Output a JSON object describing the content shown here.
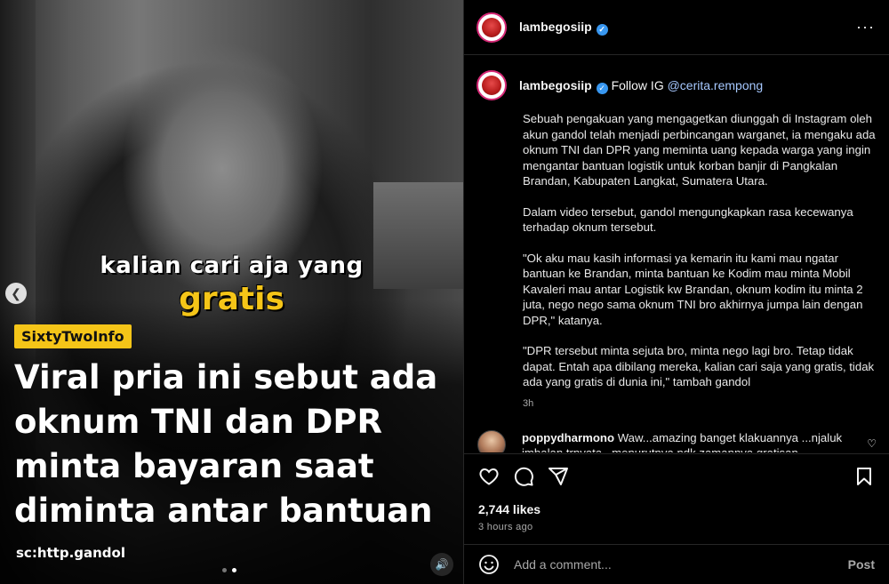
{
  "media": {
    "caption_line1": "kalian cari aja yang",
    "caption_line2": "gratis",
    "badge": "SixtyTwoInfo",
    "headline": "Viral pria ini sebut ada oknum TNI dan DPR minta bayaran saat diminta antar bantuan",
    "source": "sc:http.gandol"
  },
  "header": {
    "username": "lambegosiip"
  },
  "caption": {
    "username": "lambegosiip",
    "follow_text": "Follow IG",
    "mention": "@cerita.rempong",
    "paragraphs": [
      "Sebuah pengakuan yang mengagetkan diunggah di Instagram oleh akun gandol telah menjadi perbincangan warganet, ia mengaku ada oknum TNI dan DPR yang meminta uang kepada warga yang ingin mengantar bantuan logistik untuk korban banjir di Pangkalan Brandan, Kabupaten Langkat, Sumatera Utara.",
      "Dalam video tersebut, gandol mengungkapkan rasa kecewanya terhadap oknum tersebut.",
      "\"Ok aku mau kasih informasi ya kemarin itu kami mau ngatar bantuan ke Brandan, minta bantuan ke Kodim mau minta Mobil Kavaleri mau antar Logistik kw Brandan, oknum kodim itu minta 2 juta, nego nego sama oknum TNI bro akhirnya jumpa lain dengan DPR,\" katanya.",
      "\"DPR tersebut minta sejuta bro, minta nego lagi bro. Tetap tidak dapat. Entah apa dibilang mereka, kalian cari saja yang gratis, tidak ada yang gratis di dunia ini,\" tambah gandol"
    ],
    "time": "3h"
  },
  "comment": {
    "username": "poppydharmono",
    "text": "Waw...amazing banget klakuannya ...njaluk imbalan trnyata...menurutnya ndk zamannya gratisan...."
  },
  "stats": {
    "likes": "2,744 likes",
    "ago": "3 hours ago"
  },
  "add_comment": {
    "placeholder": "Add a comment...",
    "post_label": "Post"
  },
  "colors": {
    "badge_yellow": "#f5c518",
    "verified_blue": "#3897f0",
    "mention": "#a6c8ff"
  }
}
